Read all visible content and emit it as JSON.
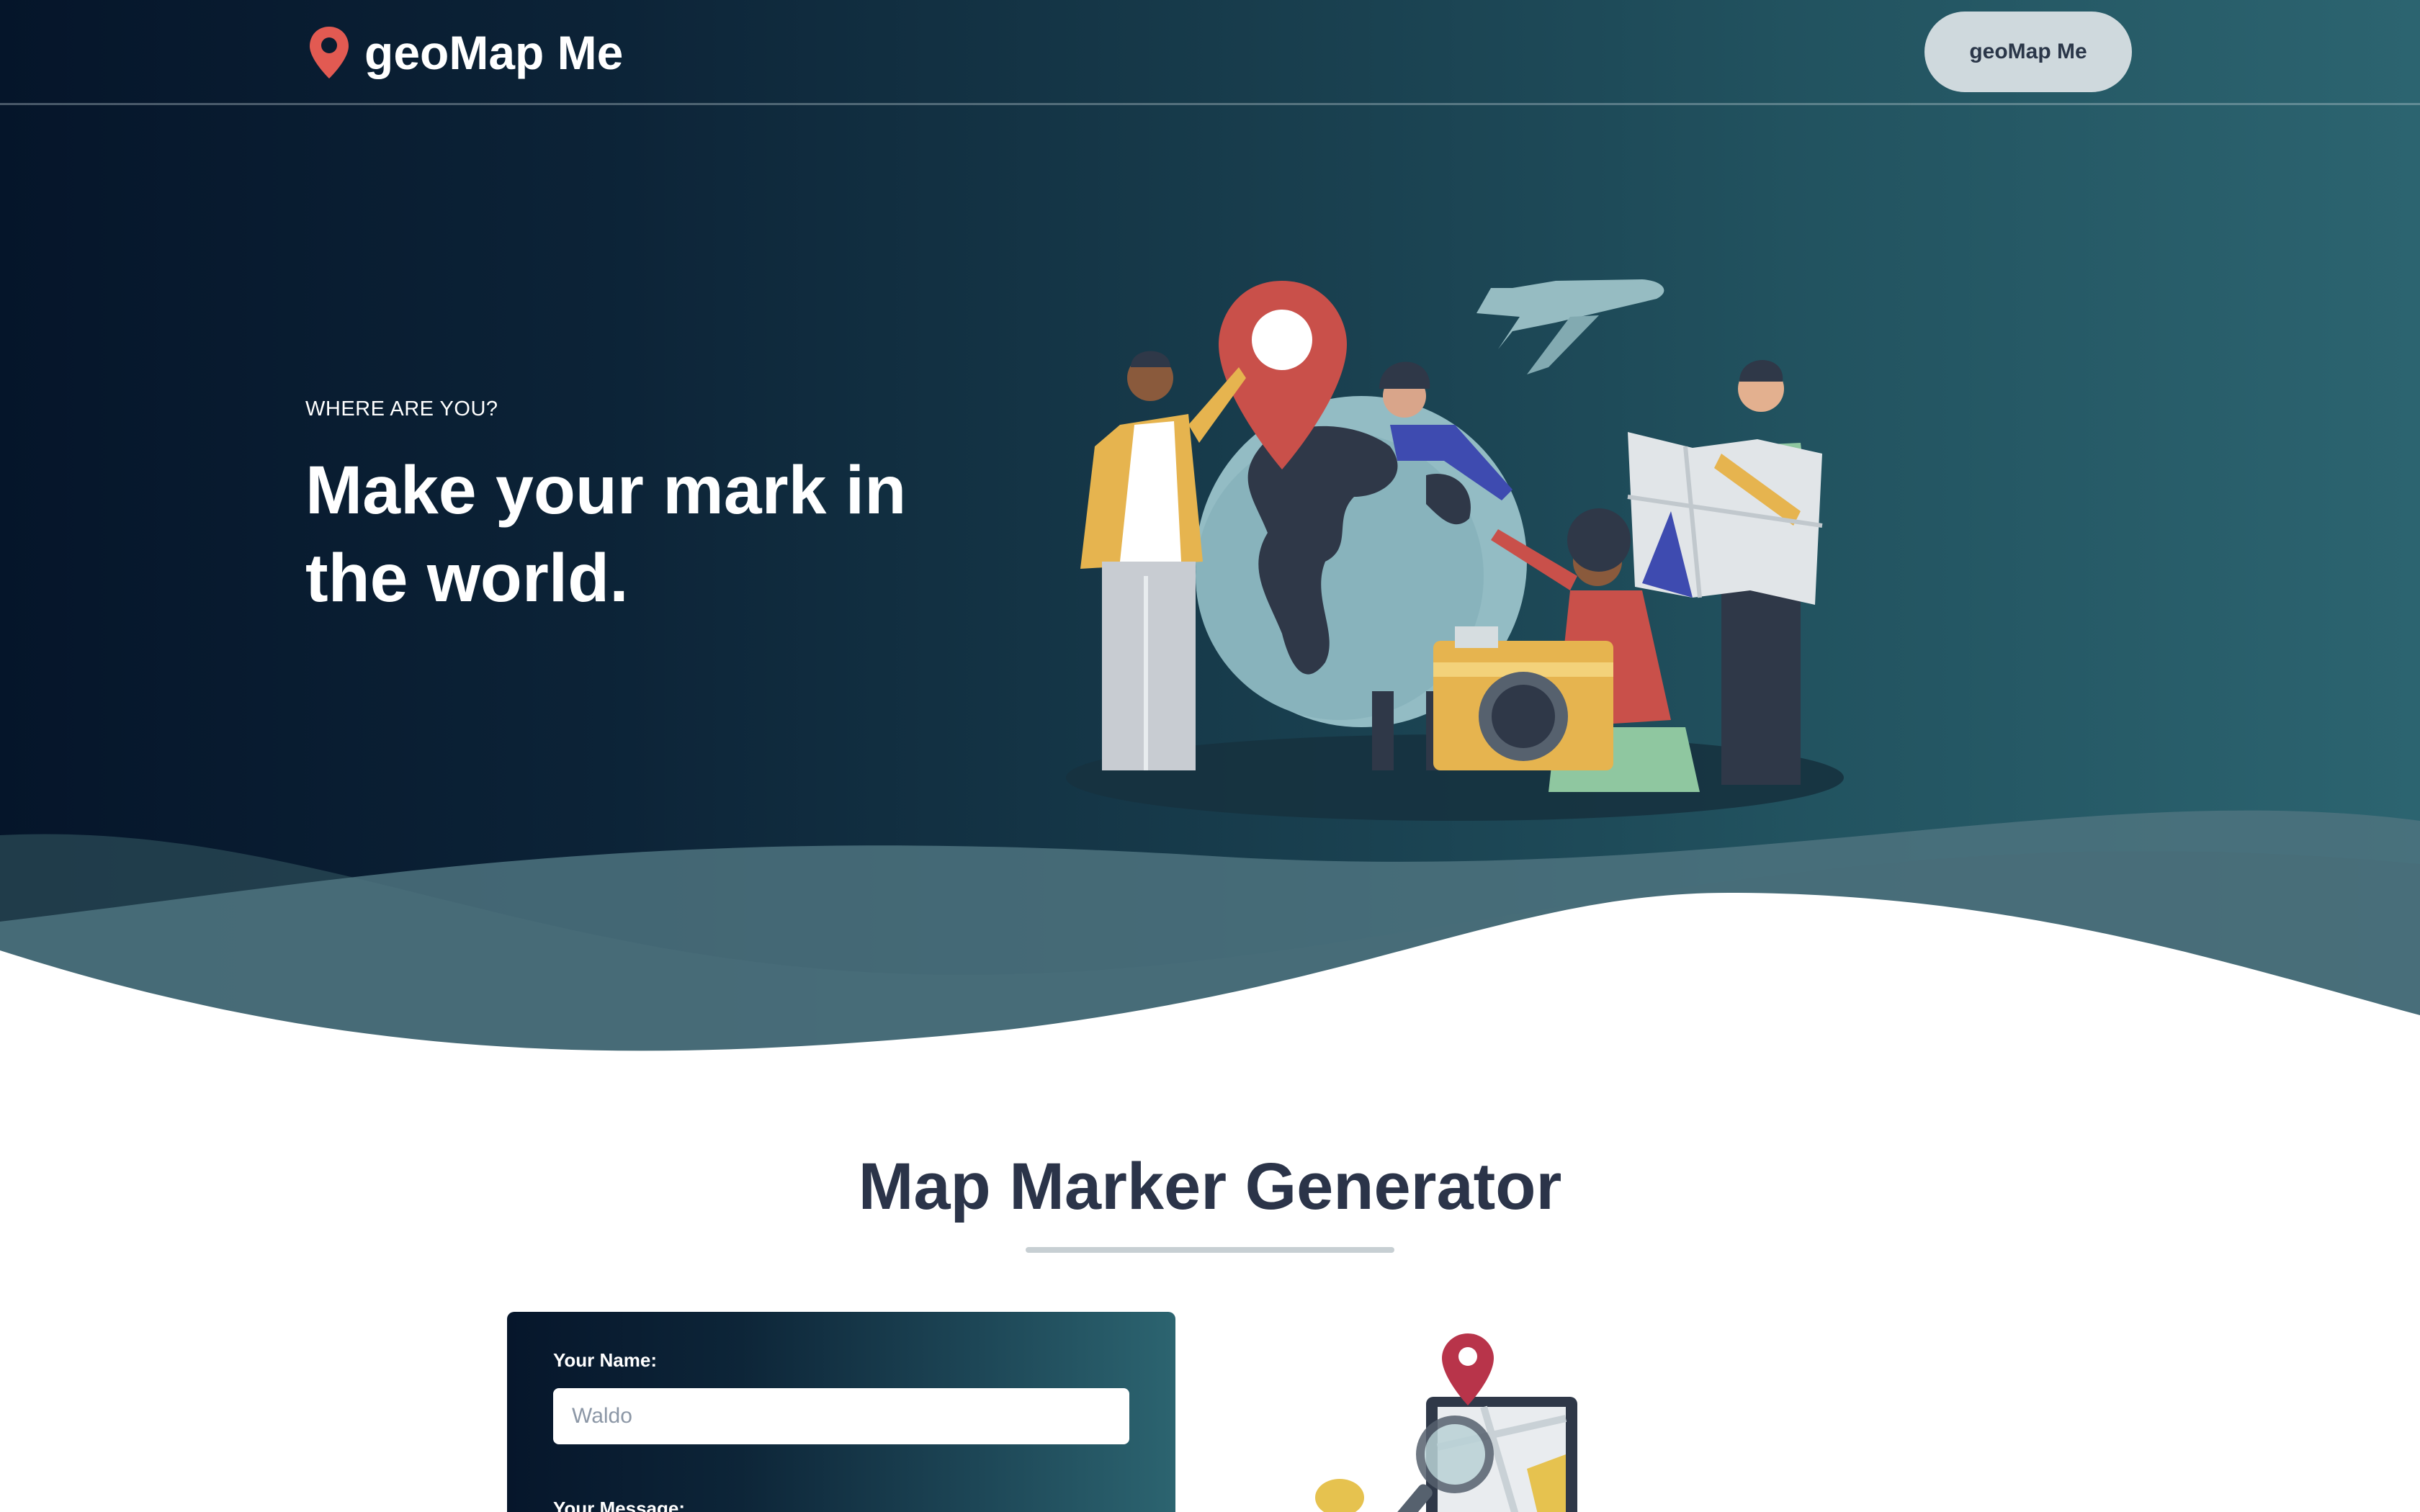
{
  "nav": {
    "brand": "geoMap Me",
    "button_label": "geoMap Me"
  },
  "hero": {
    "eyebrow": "WHERE ARE YOU?",
    "title": "Make your mark in the world."
  },
  "section": {
    "title": "Map Marker Generator"
  },
  "form": {
    "name_label": "Your Name:",
    "name_placeholder": "Waldo",
    "message_label": "Your Message:"
  },
  "colors": {
    "hero_dark": "#05152a",
    "hero_teal": "#2c6470",
    "pin_red": "#e25a52",
    "heading_navy": "#2b3449",
    "button_bg": "#cfd9dd"
  },
  "icons": {
    "brand_icon": "map-pin-icon"
  }
}
